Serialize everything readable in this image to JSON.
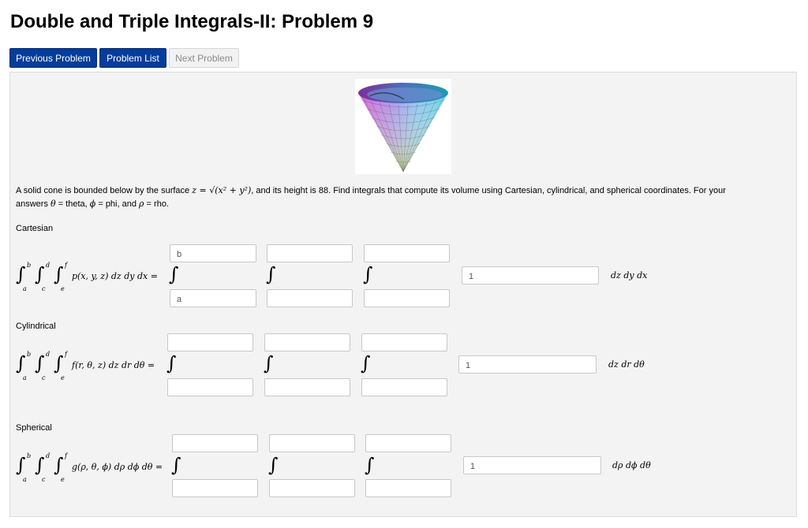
{
  "page": {
    "title": "Double and Triple Integrals-II: Problem 9"
  },
  "nav": {
    "prev": "Previous Problem",
    "list": "Problem List",
    "next": "Next Problem"
  },
  "problem": {
    "text_1": "A solid cone is bounded below by the surface ",
    "math_surface": "z = √(x² + y²)",
    "text_2": ", and its height is 88. Find integrals that compute its volume using Cartesian, cylindrical, and spherical coordinates. For your",
    "text_3": "answers ",
    "math_theta": "θ",
    "text_4": " = theta, ",
    "math_phi": "ϕ",
    "text_5": " = phi, and ",
    "math_rho": "ρ",
    "text_6": " = rho.",
    "image_alt": "cone-surface-plot"
  },
  "limits": {
    "a": "a",
    "b": "b",
    "c": "c",
    "d": "d",
    "e": "e",
    "f": "f"
  },
  "sections": [
    {
      "label": "Cartesian",
      "integrand": "p(x, y, z) dz dy dx =",
      "inputs": {
        "outer_upper": "b",
        "outer_lower": "a",
        "middle_upper": "",
        "middle_lower": "",
        "inner_upper": "",
        "inner_lower": "",
        "integrand": "1"
      },
      "differentials": "dz dy dx"
    },
    {
      "label": "Cylindrical",
      "integrand": "f(r, θ, z) dz dr dθ =",
      "inputs": {
        "outer_upper": "",
        "outer_lower": "",
        "middle_upper": "",
        "middle_lower": "",
        "inner_upper": "",
        "inner_lower": "",
        "integrand": "1"
      },
      "differentials": "dz dr dθ"
    },
    {
      "label": "Spherical",
      "integrand": "g(ρ, θ, ϕ) dρ dϕ dθ =",
      "inputs": {
        "outer_upper": "",
        "outer_lower": "",
        "middle_upper": "",
        "middle_lower": "",
        "inner_upper": "",
        "inner_lower": "",
        "integrand": "1"
      },
      "differentials": "dρ dϕ dθ"
    }
  ],
  "colors": {
    "primary_button": "#053d9a",
    "panel_bg": "#f3f3f3"
  }
}
